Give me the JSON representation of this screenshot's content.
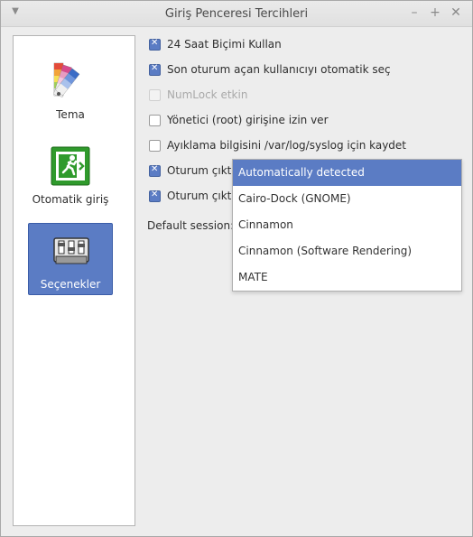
{
  "window": {
    "title": "Giriş Penceresi Tercihleri"
  },
  "sidebar": {
    "items": [
      {
        "label": "Tema",
        "icon": "color-palette-icon",
        "selected": false
      },
      {
        "label": "Otomatik giriş",
        "icon": "exit-door-icon",
        "selected": false
      },
      {
        "label": "Seçenekler",
        "icon": "settings-panel-icon",
        "selected": true
      }
    ]
  },
  "options": [
    {
      "label": "24 Saat Biçimi Kullan",
      "checked": true,
      "enabled": true
    },
    {
      "label": "Son oturum açan kullanıcıyı otomatik seç",
      "checked": true,
      "enabled": true
    },
    {
      "label": "NumLock etkin",
      "checked": false,
      "enabled": false
    },
    {
      "label": "Yönetici (root) girişine izin ver",
      "checked": false,
      "enabled": true
    },
    {
      "label": "Ayıklama bilgisini /var/log/syslog için kaydet",
      "checked": false,
      "enabled": true
    },
    {
      "label": "Oturum çıktısı",
      "checked": true,
      "enabled": true
    },
    {
      "label": "Oturum çıktısı",
      "checked": true,
      "enabled": true
    }
  ],
  "default_session": {
    "label": "Default session:",
    "options": [
      "Automatically detected",
      "Cairo-Dock (GNOME)",
      "Cinnamon",
      "Cinnamon (Software Rendering)",
      "MATE"
    ],
    "highlighted": "Automatically detected"
  },
  "colors": {
    "accent": "#5b7cc4",
    "window_bg": "#ededed"
  }
}
